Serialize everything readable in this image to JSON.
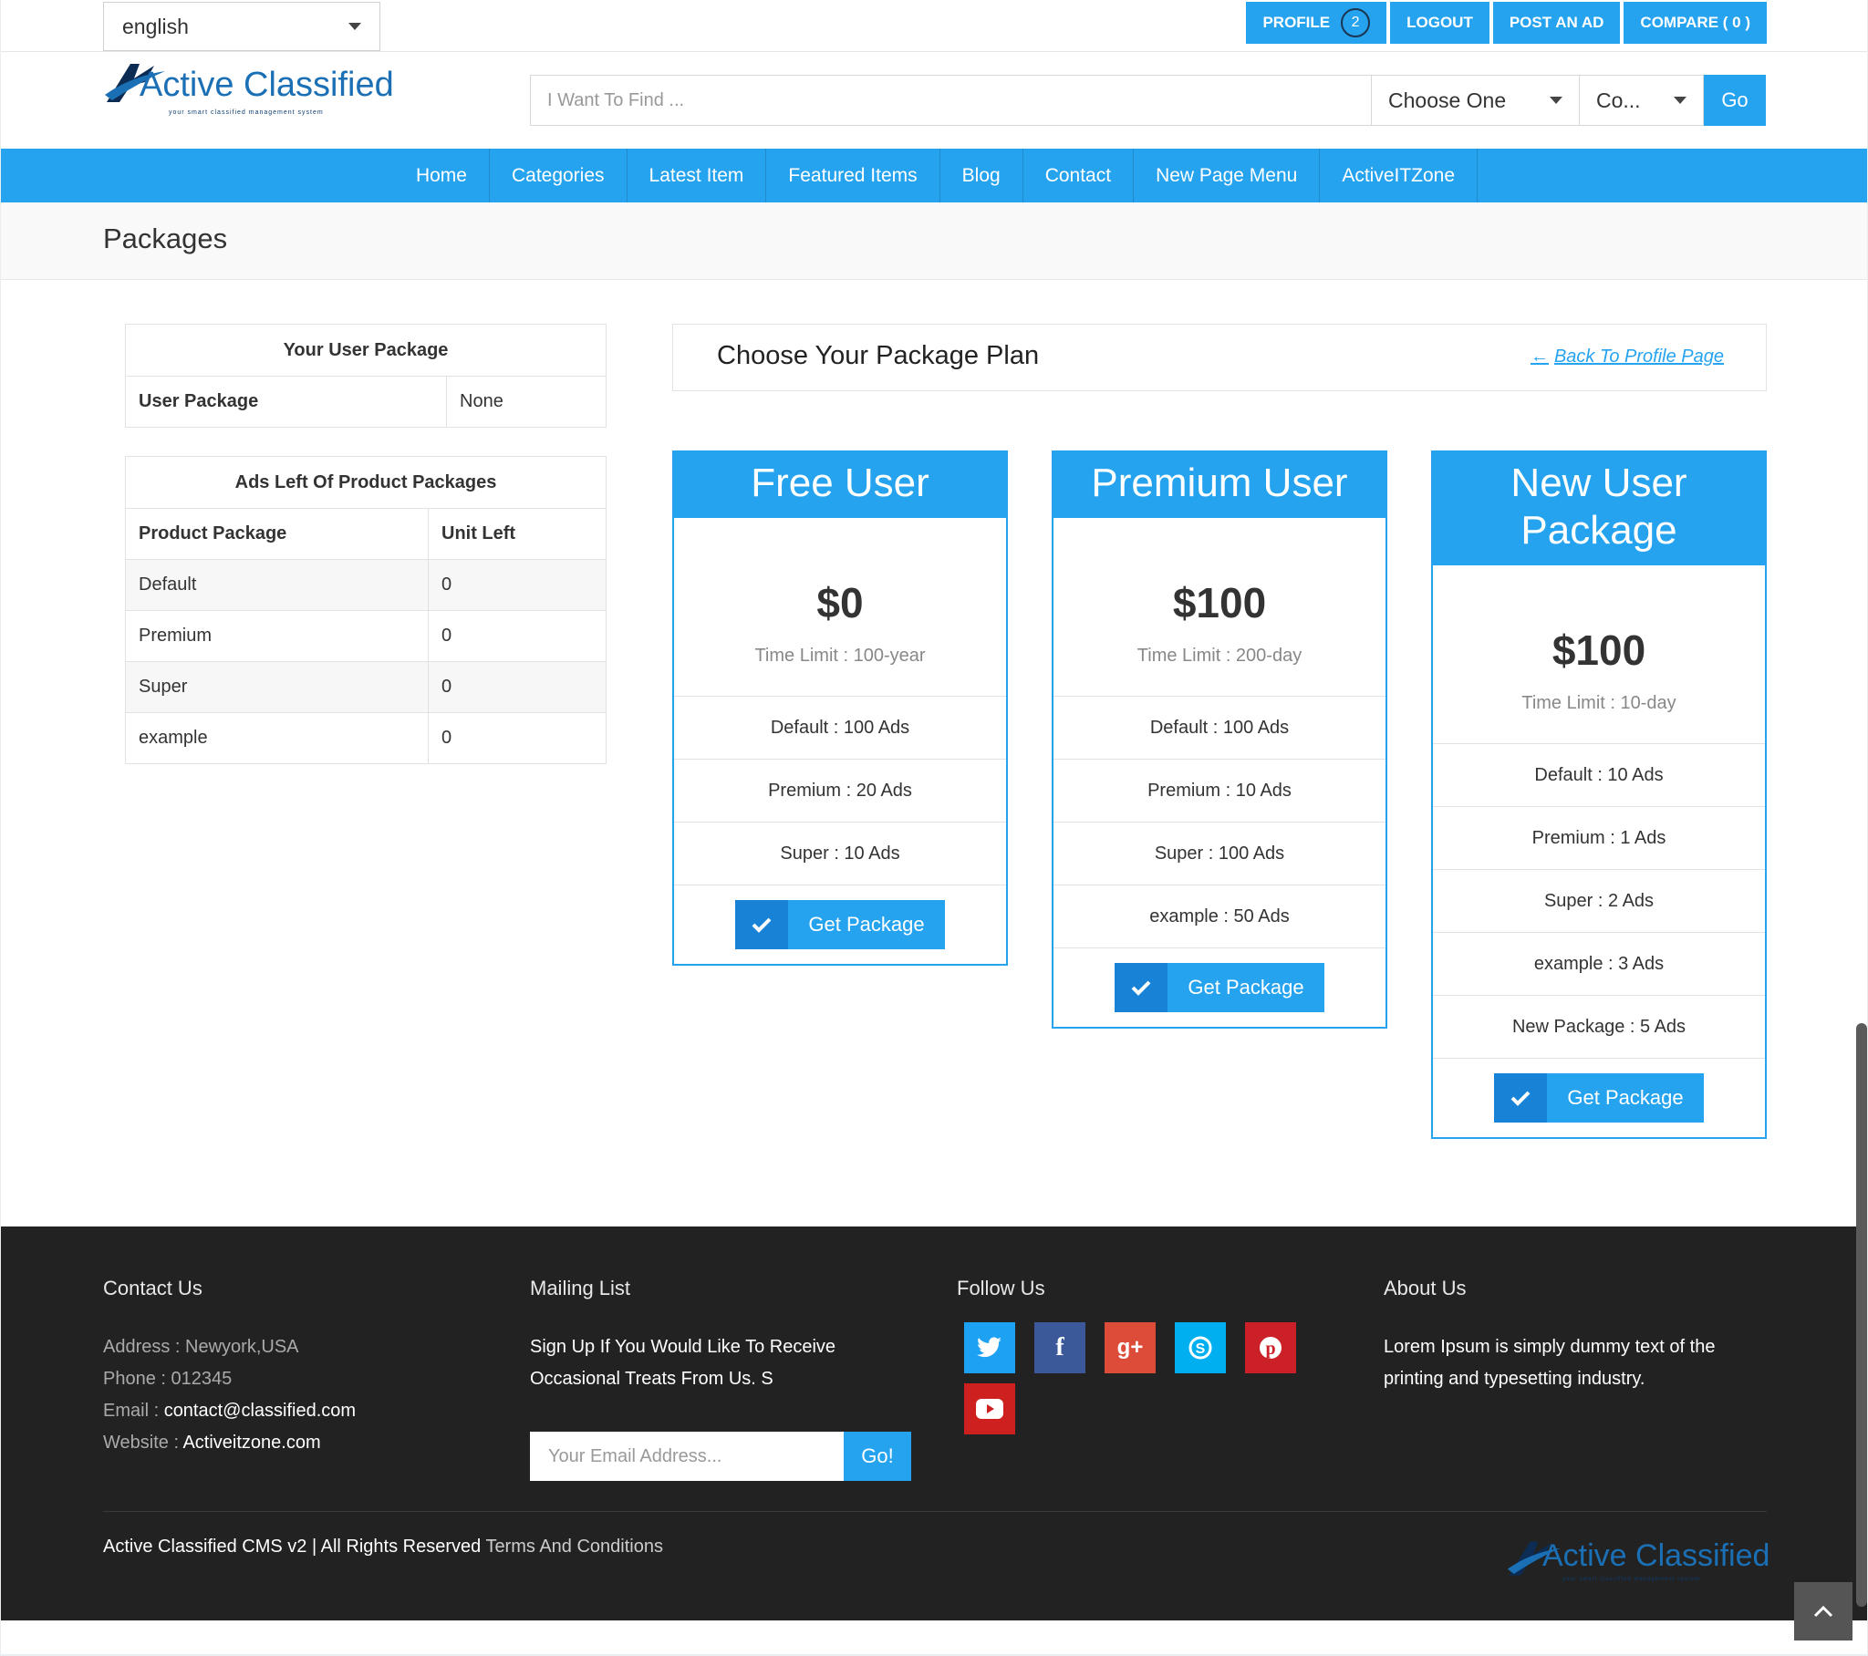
{
  "topbar": {
    "language": "english",
    "buttons": {
      "profile": "PROFILE",
      "profile_badge": "2",
      "logout": "LOGOUT",
      "post_ad": "POST AN AD",
      "compare": "COMPARE ( 0 )"
    }
  },
  "logo": {
    "text": "Active Classified",
    "tagline": "your smart classified management system"
  },
  "search": {
    "placeholder": "I Want To Find ...",
    "category_select": "Choose One",
    "location_select": "Co...",
    "go": "Go"
  },
  "nav": {
    "items": [
      "Home",
      "Categories",
      "Latest Item",
      "Featured Items",
      "Blog",
      "Contact",
      "New Page Menu",
      "ActiveITZone"
    ]
  },
  "page_title": "Packages",
  "user_package_table": {
    "header": "Your User Package",
    "label": "User Package",
    "value": "None"
  },
  "ads_left_table": {
    "header": "Ads Left Of Product Packages",
    "col1": "Product Package",
    "col2": "Unit Left",
    "rows": [
      {
        "name": "Default",
        "units": "0"
      },
      {
        "name": "Premium",
        "units": "0"
      },
      {
        "name": "Super",
        "units": "0"
      },
      {
        "name": "example",
        "units": "0"
      }
    ]
  },
  "plan": {
    "title": "Choose Your Package Plan",
    "back_link": "Back To Profile Page"
  },
  "packages": [
    {
      "name": "Free User",
      "price": "$0",
      "time_limit": "Time Limit : 100-year",
      "lines": [
        "Default : 100 Ads",
        "Premium : 20 Ads",
        "Super : 10 Ads"
      ],
      "button": "Get Package"
    },
    {
      "name": "Premium User",
      "price": "$100",
      "time_limit": "Time Limit : 200-day",
      "lines": [
        "Default : 100 Ads",
        "Premium : 10 Ads",
        "Super : 100 Ads",
        "example : 50 Ads"
      ],
      "button": "Get Package"
    },
    {
      "name_line1": "New User",
      "name_line2": "Package",
      "price": "$100",
      "time_limit": "Time Limit : 10-day",
      "lines": [
        "Default : 10 Ads",
        "Premium : 1 Ads",
        "Super : 2 Ads",
        "example : 3 Ads",
        "New Package : 5 Ads"
      ],
      "button": "Get Package"
    }
  ],
  "footer": {
    "contact": {
      "heading": "Contact Us",
      "address_label": "Address :",
      "address": "Newyork,USA",
      "phone_label": "Phone :",
      "phone": "012345",
      "email_label": "Email :",
      "email": "contact@classified.com",
      "website_label": "Website :",
      "website": "Activeitzone.com"
    },
    "mailing": {
      "heading": "Mailing List",
      "text_line1": "Sign Up If You Would Like To Receive",
      "text_line2": "Occasional Treats From Us. S",
      "placeholder": "Your Email Address...",
      "button": "Go!"
    },
    "follow": {
      "heading": "Follow Us",
      "icons": [
        "twitter-icon",
        "facebook-icon",
        "google-plus-icon",
        "skype-icon",
        "pinterest-icon",
        "youtube-icon"
      ],
      "colors": {
        "twitter": "#1da1f2",
        "facebook": "#3b5998",
        "google_plus": "#dd4b39",
        "skype": "#00aff0",
        "pinterest": "#cb2027",
        "youtube": "#cd201f"
      }
    },
    "about": {
      "heading": "About Us",
      "text_line1": "Lorem Ipsum is simply dummy text of the",
      "text_line2": "printing and typesetting industry."
    },
    "copyright": "Active Classified CMS v2 | All Rights Reserved",
    "terms": "Terms And Conditions"
  },
  "colors": {
    "accent": "#26a3ef",
    "footer_bg": "#222222"
  }
}
